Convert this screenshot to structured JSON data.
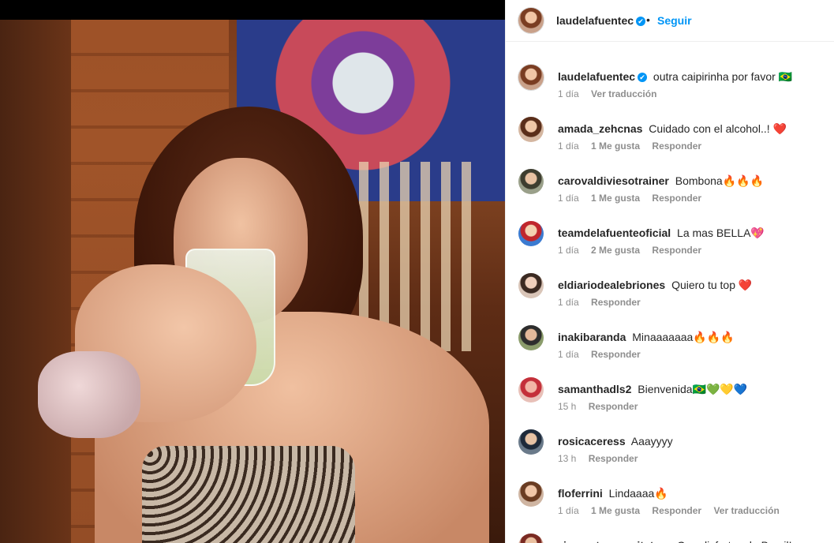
{
  "post": {
    "author": "laudelafuentec",
    "verified_mark": "✔",
    "separator": "•",
    "follow_label": "Seguir",
    "caption": {
      "username": "laudelafuentec",
      "text": "outra caipirinha por favor 🇧🇷",
      "time": "1 día",
      "translate_label": "Ver traducción"
    }
  },
  "comments": [
    {
      "username": "amada_zehcnas",
      "text": "Cuidado con el alcohol..! ❤️",
      "time": "1 día",
      "likes": "1 Me gusta",
      "reply": "Responder"
    },
    {
      "username": "carovaldiviesotrainer",
      "text": "Bombona🔥🔥🔥",
      "time": "1 día",
      "likes": "1 Me gusta",
      "reply": "Responder"
    },
    {
      "username": "teamdelafuenteoficial",
      "text": "La mas BELLA💖",
      "time": "1 día",
      "likes": "2 Me gusta",
      "reply": "Responder"
    },
    {
      "username": "eldiariodealebriones",
      "text": "Quiero tu top ❤️",
      "time": "1 día",
      "likes": "",
      "reply": "Responder"
    },
    {
      "username": "inakibaranda",
      "text": "Minaaaaaaa🔥🔥🔥",
      "time": "1 día",
      "likes": "",
      "reply": "Responder"
    },
    {
      "username": "samanthadls2",
      "text": "Bienvenida🇧🇷💚💛💙",
      "time": "15 h",
      "likes": "",
      "reply": "Responder"
    },
    {
      "username": "rosicaceress",
      "text": "Aaayyyy",
      "time": "13 h",
      "likes": "",
      "reply": "Responder"
    },
    {
      "username": "floferrini",
      "text": "Lindaaaa🔥",
      "time": "1 día",
      "likes": "1 Me gusta",
      "reply": "Responder",
      "translate": "Ver traducción"
    },
    {
      "username": "zinarestonarquitetura",
      "text": "Que disfrutes de Brasil!",
      "time": "",
      "likes": "",
      "reply": ""
    }
  ]
}
